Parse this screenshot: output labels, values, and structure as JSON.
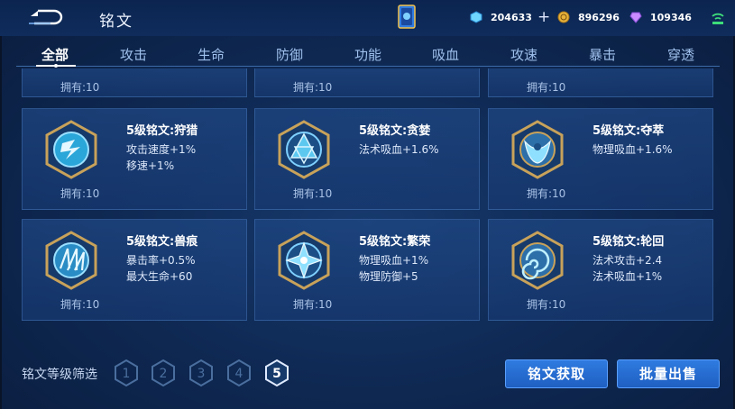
{
  "header": {
    "title": "铭文",
    "currencies": [
      {
        "name": "diamond",
        "icon": "diamond-icon",
        "value": "204633"
      },
      {
        "name": "gold",
        "icon": "gold-coin-icon",
        "value": "896296"
      },
      {
        "name": "gem",
        "icon": "gem-icon",
        "value": "109346"
      }
    ]
  },
  "tabs": [
    "全部",
    "攻击",
    "生命",
    "防御",
    "功能",
    "吸血",
    "攻速",
    "暴击",
    "穿透"
  ],
  "active_tab": "全部",
  "owned_prefix": "拥有:",
  "partial_cards": [
    {
      "owned": "拥有:10"
    },
    {
      "owned": "拥有:10"
    },
    {
      "owned": "拥有:10"
    }
  ],
  "cards": [
    {
      "name": "5级铭文:狩猎",
      "stats": [
        "攻击速度+1%",
        "移速+1%"
      ],
      "owned": "拥有:10",
      "icon": "hunt-rune-icon"
    },
    {
      "name": "5级铭文:贪婪",
      "stats": [
        "法术吸血+1.6%"
      ],
      "owned": "拥有:10",
      "icon": "greed-rune-icon"
    },
    {
      "name": "5级铭文:夺萃",
      "stats": [
        "物理吸血+1.6%"
      ],
      "owned": "拥有:10",
      "icon": "extract-rune-icon"
    },
    {
      "name": "5级铭文:兽痕",
      "stats": [
        "暴击率+0.5%",
        "最大生命+60"
      ],
      "owned": "拥有:10",
      "icon": "beast-rune-icon"
    },
    {
      "name": "5级铭文:繁荣",
      "stats": [
        "物理吸血+1%",
        "物理防御+5"
      ],
      "owned": "拥有:10",
      "icon": "prosper-rune-icon"
    },
    {
      "name": "5级铭文:轮回",
      "stats": [
        "法术攻击+2.4",
        "法术吸血+1%"
      ],
      "owned": "拥有:10",
      "icon": "cycle-rune-icon"
    }
  ],
  "footer": {
    "filter_label": "铭文等级筛选",
    "levels": [
      "1",
      "2",
      "3",
      "4",
      "5"
    ],
    "selected_level": "5",
    "acquire_button": "铭文获取",
    "sell_button": "批量出售"
  },
  "colors": {
    "accent": "#2f7be0",
    "panel": "#1e4682",
    "gold": "#c8a25a"
  }
}
